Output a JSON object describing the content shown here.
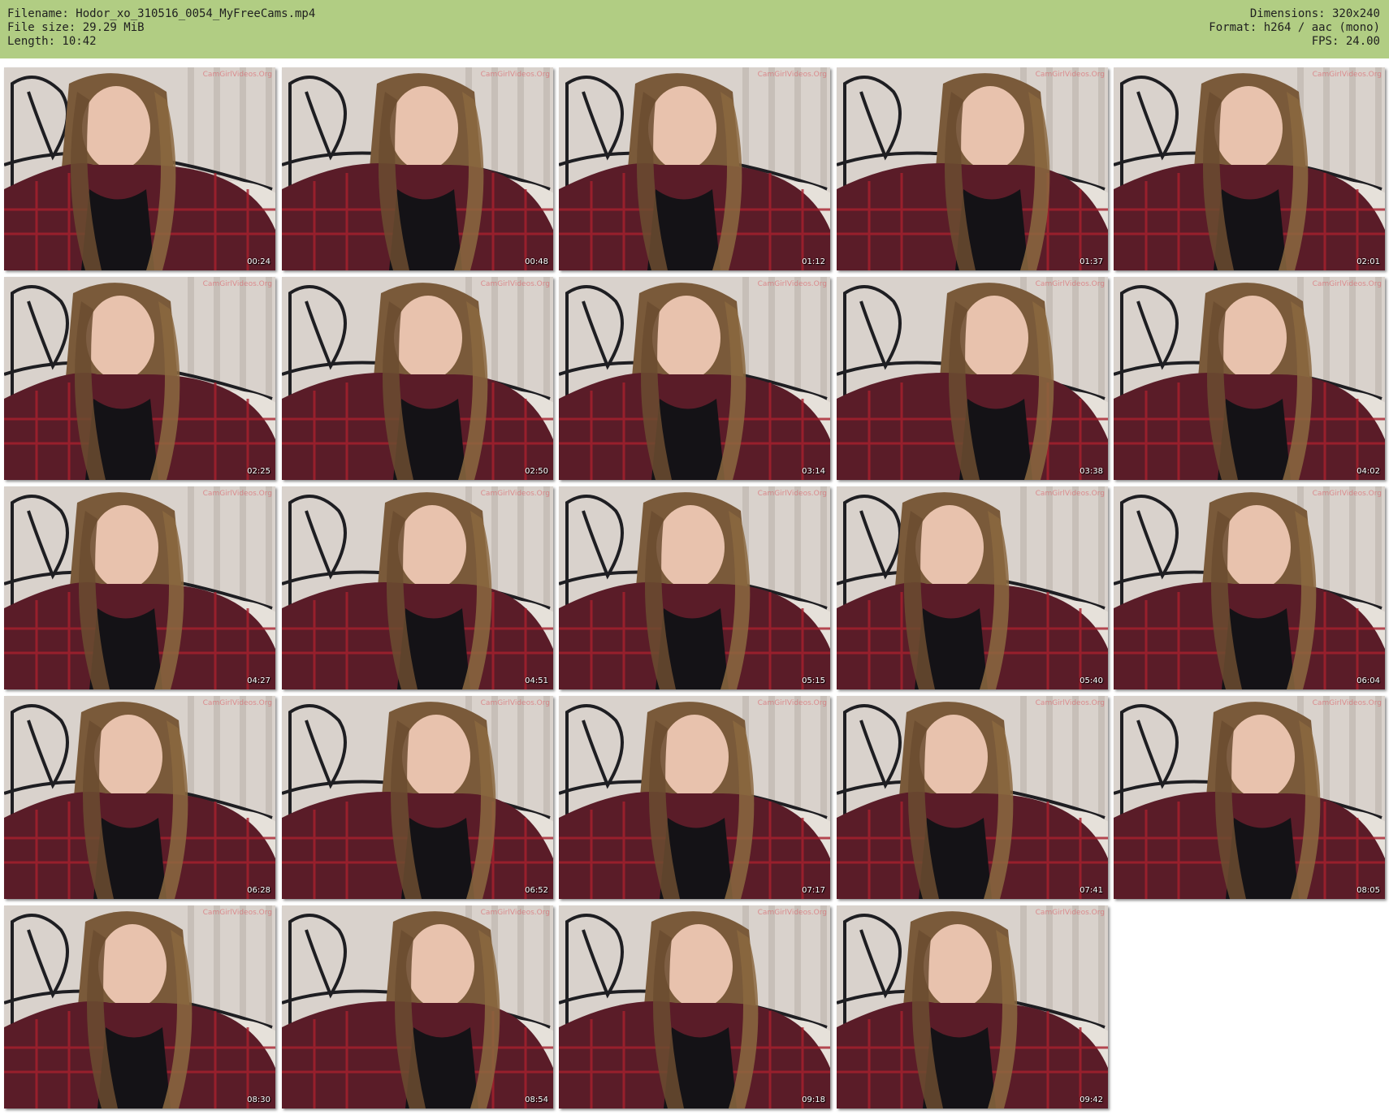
{
  "header": {
    "filename": "Filename: Hodor_xo_310516_0054_MyFreeCams.mp4",
    "filesize": "File size: 29.29 MiB",
    "length": "Length: 10:42",
    "dimensions": "Dimensions: 320x240",
    "format": "Format: h264 / aac (mono)",
    "fps": "FPS: 24.00"
  },
  "watermark": "CamGirlVideos.Org",
  "thumbnails": [
    {
      "time": "00:24"
    },
    {
      "time": "00:48"
    },
    {
      "time": "01:12"
    },
    {
      "time": "01:37"
    },
    {
      "time": "02:01"
    },
    {
      "time": "02:25"
    },
    {
      "time": "02:50"
    },
    {
      "time": "03:14"
    },
    {
      "time": "03:38"
    },
    {
      "time": "04:02"
    },
    {
      "time": "04:27"
    },
    {
      "time": "04:51"
    },
    {
      "time": "05:15"
    },
    {
      "time": "05:40"
    },
    {
      "time": "06:04"
    },
    {
      "time": "06:28"
    },
    {
      "time": "06:52"
    },
    {
      "time": "07:17"
    },
    {
      "time": "07:41"
    },
    {
      "time": "08:05"
    },
    {
      "time": "08:30"
    },
    {
      "time": "08:54"
    },
    {
      "time": "09:18"
    },
    {
      "time": "09:42"
    }
  ],
  "colors": {
    "header_bg": "#b1cd83",
    "wall": "#d9d2cc",
    "hair": "#7a5a3a",
    "skin": "#e8c2ad",
    "shirt": "#5a1c28"
  }
}
